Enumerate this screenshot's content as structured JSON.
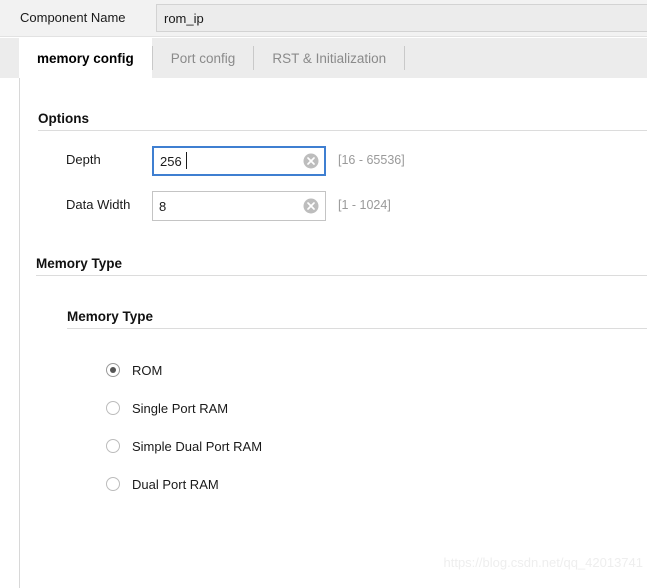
{
  "component": {
    "label": "Component Name",
    "value": "rom_ip",
    "placeholder": ""
  },
  "tabs": [
    {
      "label": "memory config",
      "active": true
    },
    {
      "label": "Port config",
      "active": false
    },
    {
      "label": "RST & Initialization",
      "active": false
    }
  ],
  "sections": {
    "options": {
      "title": "Options",
      "fields": [
        {
          "label": "Depth",
          "value": "256",
          "hint": "[16 - 65536]",
          "focused": true,
          "clear_icon": "clear-circle-icon"
        },
        {
          "label": "Data Width",
          "value": "8",
          "hint": "[1 - 1024]",
          "focused": false,
          "clear_icon": "clear-circle-icon"
        }
      ]
    },
    "memory_type_outer": {
      "title": "Memory Type"
    },
    "memory_type_inner": {
      "title": "Memory Type",
      "options": [
        {
          "label": "ROM",
          "selected": true
        },
        {
          "label": "Single Port RAM",
          "selected": false
        },
        {
          "label": "Simple Dual Port RAM",
          "selected": false
        },
        {
          "label": "Dual Port RAM",
          "selected": false
        }
      ]
    }
  },
  "watermark": "https://blog.csdn.net/qq_42013741",
  "colors": {
    "focus_border": "#3f7fd1",
    "strip_bg": "#ececec",
    "hint_text": "#9a9a9a",
    "rule": "#dcdcdc"
  }
}
